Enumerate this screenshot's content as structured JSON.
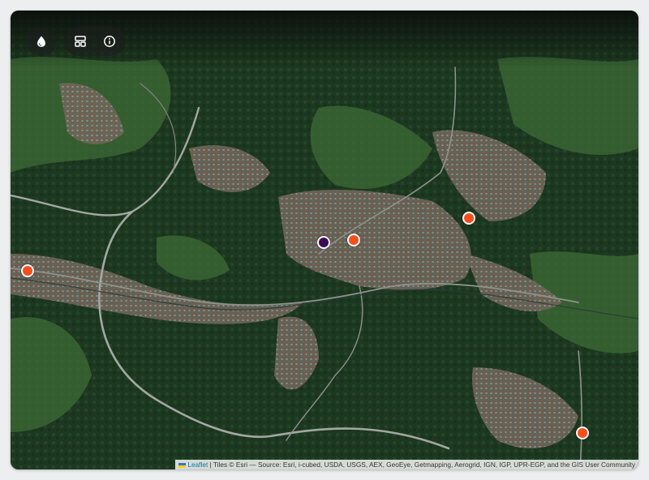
{
  "controls": {
    "layer_icon": "droplet-icon",
    "layout_icon": "layout-icon",
    "info_icon": "info-icon"
  },
  "colors": {
    "marker_default": "#ff4d1a",
    "marker_selected": "#3b0a57",
    "forest": "#1f3a22",
    "urban": "#6e6a60",
    "road": "#9aa19a"
  },
  "markers": [
    {
      "id": "marker-west",
      "status": "default"
    },
    {
      "id": "marker-center-selected",
      "status": "selected"
    },
    {
      "id": "marker-center",
      "status": "default"
    },
    {
      "id": "marker-northeast",
      "status": "default"
    },
    {
      "id": "marker-southeast",
      "status": "default"
    }
  ],
  "attribution": {
    "leaflet_link": "Leaflet",
    "separator": " | ",
    "tiles_text": "Tiles © Esri — Source: Esri, i-cubed, USDA, USGS, AEX, GeoEye, Getmapping, Aerogrid, IGN, IGP, UPR-EGP, and the GIS User Community"
  }
}
